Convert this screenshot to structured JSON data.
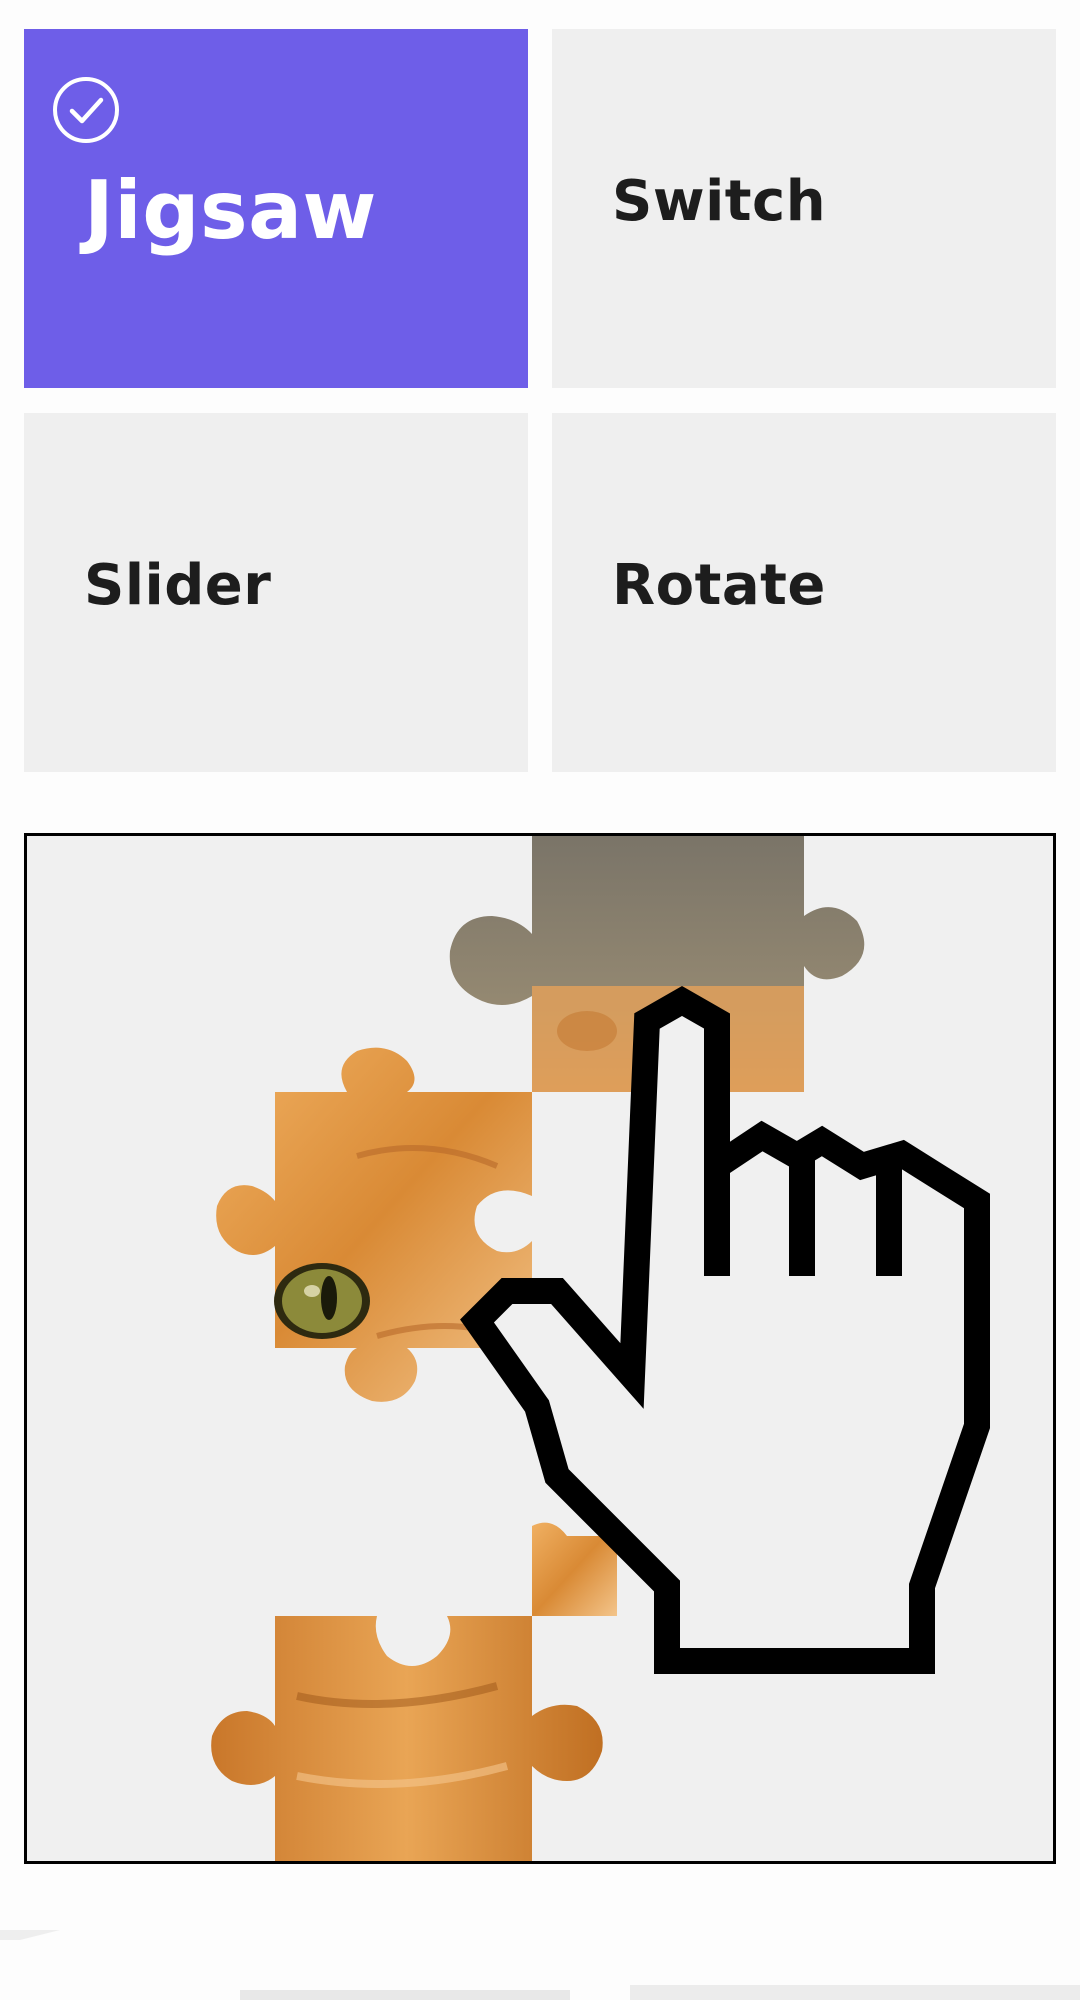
{
  "modes": {
    "jigsaw": {
      "label": "Jigsaw",
      "selected": true
    },
    "switch": {
      "label": "Switch",
      "selected": false
    },
    "slider": {
      "label": "Slider",
      "selected": false
    },
    "rotate": {
      "label": "Rotate",
      "selected": false
    }
  },
  "colors": {
    "selected_card": "#6e5ee8",
    "card": "#efefef",
    "label": "#1d1d1d"
  },
  "preview": {
    "pieces_icon": "cat-jigsaw-pieces",
    "gesture_icon": "pointing-hand-icon"
  }
}
